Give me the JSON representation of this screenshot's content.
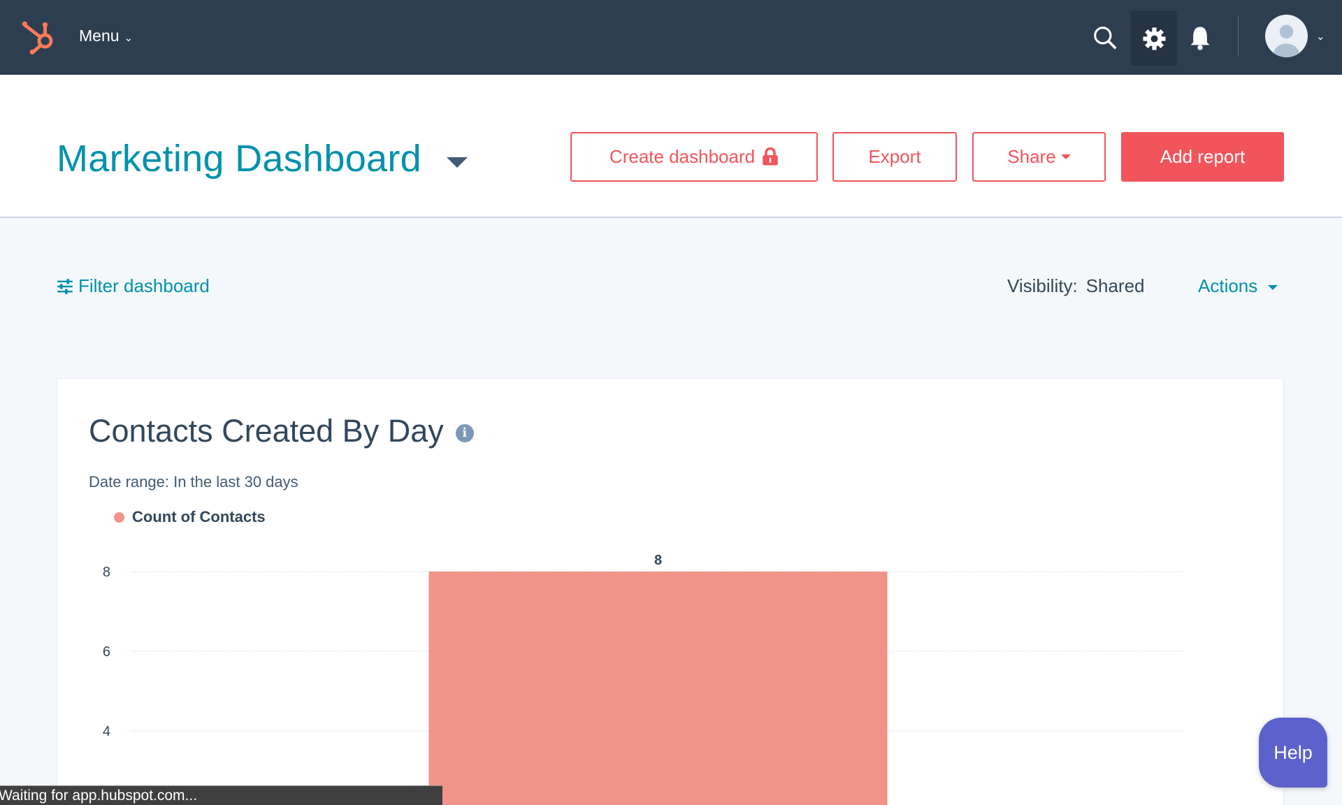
{
  "topbar": {
    "menu_label": "Menu",
    "icons": [
      "hubspot-logo",
      "search-icon",
      "gear-icon",
      "bell-icon",
      "avatar"
    ]
  },
  "header": {
    "title": "Marketing Dashboard",
    "buttons": {
      "create": "Create dashboard",
      "export": "Export",
      "share": "Share",
      "add": "Add report"
    }
  },
  "toolbar": {
    "filter": "Filter dashboard",
    "visibility_label": "Visibility:",
    "visibility_value": "Shared",
    "actions": "Actions"
  },
  "report": {
    "title": "Contacts Created By Day",
    "date_range": "Date range:  In the last 30 days"
  },
  "chart_data": {
    "type": "bar",
    "categories": [
      ""
    ],
    "series": [
      {
        "name": "Count of Contacts",
        "values": [
          8
        ],
        "color": "#f2938a"
      }
    ],
    "data_labels": [
      "8"
    ],
    "y_ticks": [
      "8",
      "6",
      "4"
    ],
    "grid": true,
    "legend": "top-left"
  },
  "status_bar": "Waiting for app.hubspot.com...",
  "help": "Help",
  "colors": {
    "nav": "#2d3e50",
    "accent": "#f2545b",
    "link": "#0091ae",
    "help": "#5c62cc"
  }
}
